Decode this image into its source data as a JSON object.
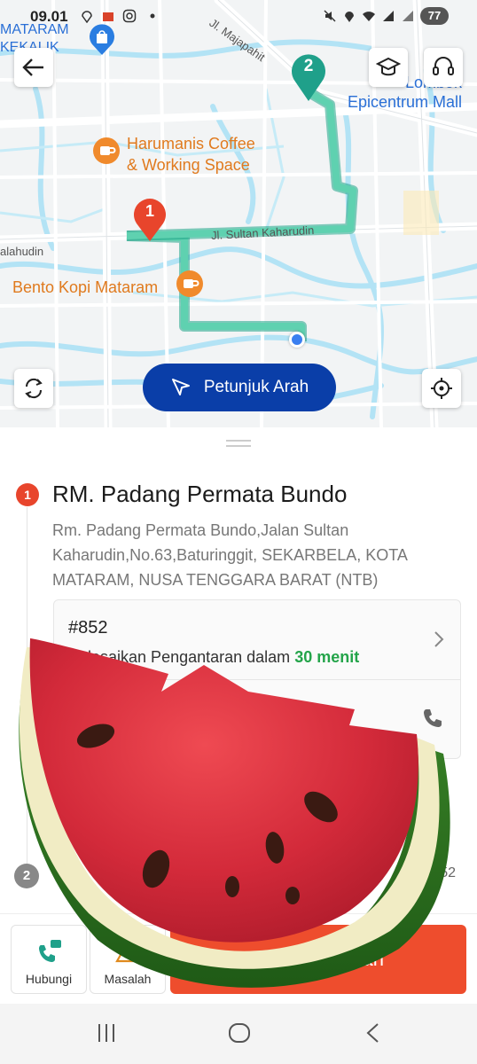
{
  "status_bar": {
    "time": "09.01",
    "battery": "77"
  },
  "map": {
    "labels": {
      "mataram_kekalik": "MATARAM\nKEKALIK",
      "jl_majapahit": "Jl. Majapahit",
      "lombok_epicentrum": "Lombok\nEpicentrum Mall",
      "harumanis": "Harumanis Coffee\n& Working Space",
      "jl_sultan_kaharudin": "Jl. Sultan Kaharudin",
      "salahudin": "alahudin",
      "bento_kopi": "Bento Kopi Mataram"
    },
    "markers": {
      "pickup_number": "1",
      "dropoff_number": "2"
    },
    "directions_button": "Petunjuk Arah",
    "colors": {
      "route": "#5fd1b0",
      "marker_pickup": "#e8452c",
      "marker_dropoff": "#1fa08a",
      "water": "#b3e3f5",
      "road": "#ffffff",
      "directions": "#0a3ea8"
    },
    "icons": {
      "back": "arrow-left-icon",
      "training": "graduation-cap-icon",
      "support": "headset-icon",
      "refresh": "refresh-icon",
      "locate": "crosshair-icon"
    }
  },
  "order": {
    "stop_number": "1",
    "store_name": "RM. Padang Permata Bundo",
    "address": "Rm. Padang Permata Bundo,Jalan Sultan Kaharudin,No.63,Baturinggit, SEKARBELA, KOTA MATARAM, NUSA TENGGARA BARAT (NTB)",
    "order_id": "#852",
    "deliver_prefix": "Selesaikan Pengantaran dalam ",
    "deliver_time": "30 menit",
    "seller_name": "RM. Padang Permata Bundo",
    "second_stop_number": "2",
    "second_order_id": "#852"
  },
  "actions": {
    "call_label": "Hubungi",
    "issue_label": "Masalah",
    "primary_label": "Ambil Pesanan"
  },
  "colors": {
    "accent": "#ee4d2d",
    "success": "#24a44a"
  }
}
